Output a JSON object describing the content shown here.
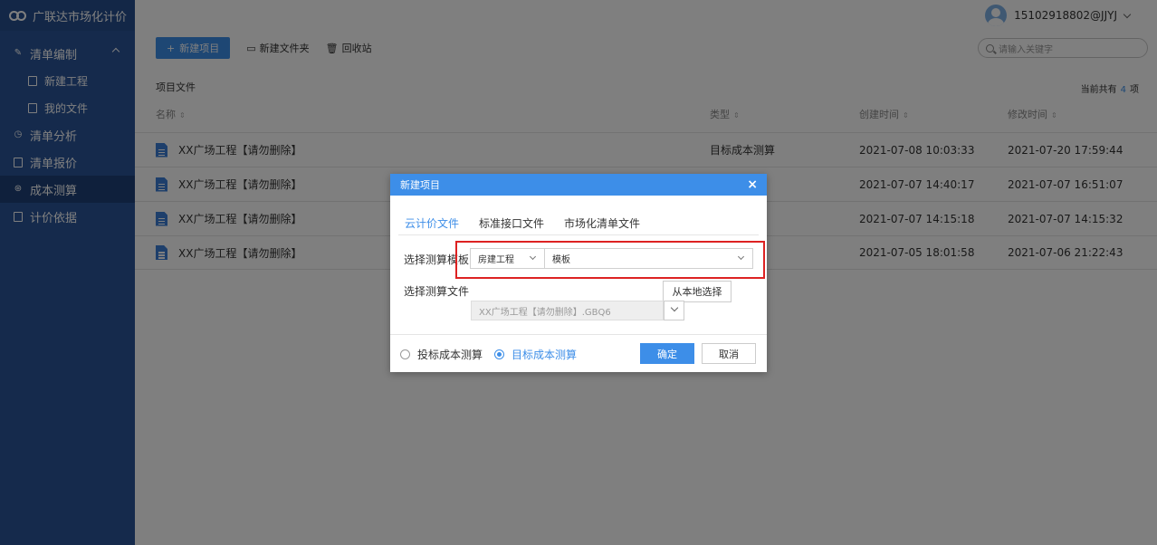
{
  "app": {
    "title": "广联达市场化计价"
  },
  "sidebar": {
    "items": [
      {
        "label": "清单编制",
        "icon": "edit-icon",
        "expanded": true
      },
      {
        "label": "新建工程",
        "icon": "file-icon",
        "sub": true
      },
      {
        "label": "我的文件",
        "icon": "file-icon",
        "sub": true
      },
      {
        "label": "清单分析",
        "icon": "clock-icon"
      },
      {
        "label": "清单报价",
        "icon": "quote-icon"
      },
      {
        "label": "成本测算",
        "icon": "calc-icon",
        "active": true
      },
      {
        "label": "计价依据",
        "icon": "book-icon"
      }
    ]
  },
  "header": {
    "user": "15102918802@JJYJ"
  },
  "toolbar": {
    "new_project": "新建项目",
    "new_folder": "新建文件夹",
    "recycle": "回收站",
    "search_placeholder": "请输入关键字"
  },
  "list": {
    "title": "项目文件",
    "count_prefix": "当前共有",
    "count": "4",
    "count_suffix": "项",
    "columns": {
      "name": "名称",
      "type": "类型",
      "created": "创建时间",
      "modified": "修改时间"
    },
    "rows": [
      {
        "name": "XX广场工程【请勿删除】",
        "type": "目标成本测算",
        "created": "2021-07-08 10:03:33",
        "modified": "2021-07-20 17:59:44"
      },
      {
        "name": "XX广场工程【请勿删除】",
        "type": "",
        "created": "2021-07-07 14:40:17",
        "modified": "2021-07-07 16:51:07"
      },
      {
        "name": "XX广场工程【请勿删除】",
        "type": "",
        "created": "2021-07-07 14:15:18",
        "modified": "2021-07-07 14:15:32"
      },
      {
        "name": "XX广场工程【请勿删除】",
        "type": "",
        "created": "2021-07-05 18:01:58",
        "modified": "2021-07-06 21:22:43"
      }
    ]
  },
  "modal": {
    "title": "新建项目",
    "close": "×",
    "tabs": [
      "云计价文件",
      "标准接口文件",
      "市场化清单文件"
    ],
    "template_label": "选择测算模板",
    "template_select_1": "房建工程",
    "template_select_2": "模板",
    "file_label": "选择测算文件",
    "local_button": "从本地选择",
    "file_value": "XX广场工程【请勿删除】.GBQ6",
    "radio_1": "投标成本测算",
    "radio_2": "目标成本测算",
    "radio_selected": "目标成本测算",
    "ok": "确定",
    "cancel": "取消"
  },
  "colors": {
    "primary": "#3d8ee8",
    "sidebar": "#2b5598",
    "highlight": "#dd2222"
  }
}
